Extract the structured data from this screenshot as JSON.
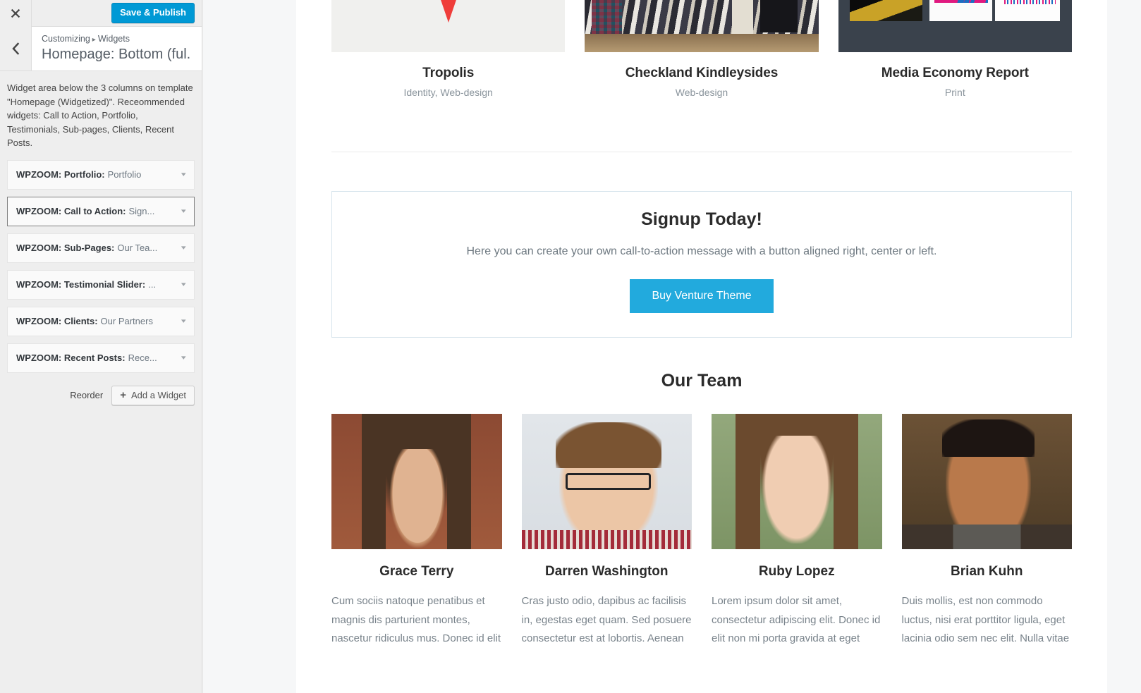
{
  "sidebar": {
    "close_label": "×",
    "save_publish_label": "Save & Publish",
    "breadcrumb_root": "Customizing",
    "breadcrumb_sep": "▸",
    "breadcrumb_current": "Widgets",
    "panel_title": "Homepage: Bottom (ful...",
    "description": "Widget area below the 3 columns on template \"Homepage (Widgetized)\". Receommended widgets: Call to Action, Portfolio, Testimonials, Sub-pages, Clients, Recent Posts.",
    "widgets": [
      {
        "prefix": "WPZOOM: Portfolio:",
        "name": "Portfolio",
        "focused": false
      },
      {
        "prefix": "WPZOOM: Call to Action:",
        "name": "Sign...",
        "focused": true
      },
      {
        "prefix": "WPZOOM: Sub-Pages:",
        "name": "Our Tea...",
        "focused": false
      },
      {
        "prefix": "WPZOOM: Testimonial Slider:",
        "name": "...",
        "focused": false
      },
      {
        "prefix": "WPZOOM: Clients:",
        "name": "Our Partners",
        "focused": false
      },
      {
        "prefix": "WPZOOM: Recent Posts:",
        "name": "Rece...",
        "focused": false
      }
    ],
    "reorder_label": "Reorder",
    "add_widget_label": "Add a Widget",
    "add_widget_plus": "+",
    "caret_glyph": "▾",
    "accent_color": "#0099d5"
  },
  "preview": {
    "portfolio": [
      {
        "title": "Tropolis",
        "category": "Identity, Web-design"
      },
      {
        "title": "Checkland Kindleysides",
        "category": "Web-design"
      },
      {
        "title": "Media Economy Report",
        "category": "Print"
      }
    ],
    "cta": {
      "title": "Signup Today!",
      "text": "Here you can create your own call-to-action message with a button aligned right, center or left.",
      "button_label": "Buy Venture Theme",
      "button_color": "#22aadd"
    },
    "team": {
      "heading": "Our Team",
      "members": [
        {
          "name": "Grace Terry",
          "bio": "Cum sociis natoque penatibus et magnis dis parturient montes, nascetur ridiculus mus. Donec id elit"
        },
        {
          "name": "Darren Washington",
          "bio": "Cras justo odio, dapibus ac facilisis in, egestas eget quam. Sed posuere consectetur est at lobortis. Aenean"
        },
        {
          "name": "Ruby Lopez",
          "bio": "Lorem ipsum dolor sit amet, consectetur adipiscing elit. Donec id elit non mi porta gravida at eget"
        },
        {
          "name": "Brian Kuhn",
          "bio": "Duis mollis, est non commodo luctus, nisi erat porttitor ligula, eget lacinia odio sem nec elit. Nulla vitae"
        }
      ]
    }
  }
}
